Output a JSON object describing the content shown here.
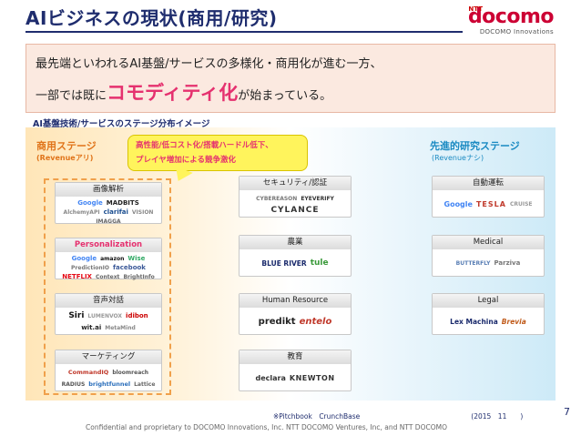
{
  "header": {
    "title": "AIビジネスの現状(商用/研究)",
    "logo_ntt": "NTT",
    "logo_brand": "docomo",
    "logo_sub": "DOCOMO Innovations"
  },
  "callout": {
    "line1": "最先端といわれるAI基盤/サービスの多様化・商用化が進む一方、",
    "line2_prefix": "一部では既に",
    "line2_highlight": "コモディティ化",
    "line2_suffix": "が始まっている。"
  },
  "section_label": "AI基盤技術/サービスのステージ分布イメージ",
  "stages": {
    "left_title": "商用ステージ",
    "left_sub": "(Revenueアリ)",
    "right_title": "先進的研究ステージ",
    "right_sub": "(Revenueナシ)"
  },
  "bubble": {
    "line1": "高性能/低コスト化/搭載ハードル低下、",
    "line2": "プレイヤ増加による競争激化"
  },
  "cards": {
    "image": {
      "label": "画像解析",
      "logos": [
        "Google",
        "MADBITS",
        "AlchemyAPI",
        "clarifai",
        "VISION",
        "IMAGGA"
      ]
    },
    "personalization": {
      "label": "Personalization",
      "logos": [
        "Google",
        "amazon",
        "Wise",
        "PredictionIO",
        "facebook",
        "NETFLIX",
        "Context",
        "BrightInfo"
      ]
    },
    "voice": {
      "label": "音声対話",
      "logos": [
        "Siri",
        "LUMENVOX",
        "wit.ai",
        "idibon",
        "MetaMind"
      ]
    },
    "marketing": {
      "label": "マーケティング",
      "logos": [
        "CommandIQ",
        "bloomreach",
        "RADIUS",
        "brightfunnel",
        "Lattice"
      ]
    },
    "security": {
      "label": "セキュリティ/認証",
      "logos": [
        "CYBEREASON",
        "EYEVERIFY",
        "CYLANCE"
      ]
    },
    "agri": {
      "label": "農業",
      "logos": [
        "BLUE RIVER",
        "tule"
      ]
    },
    "hr": {
      "label": "Human Resource",
      "logos": [
        "predikt",
        "entelo"
      ]
    },
    "edu": {
      "label": "教育",
      "logos": [
        "declara",
        "KNEWTON"
      ]
    },
    "auto": {
      "label": "自動運転",
      "logos": [
        "Google",
        "TESLA",
        "CRUISE"
      ]
    },
    "medical": {
      "label": "Medical",
      "logos": [
        "BUTTERFLY",
        "Parziva"
      ]
    },
    "legal": {
      "label": "Legal",
      "logos": [
        "Lex Machina",
        "Brevia"
      ]
    }
  },
  "footer": {
    "source": "※Pitchbook　CrunchBase",
    "date": "(2015　11　　)",
    "copyright": "Confidential and proprietary to DOCOMO Innovations, Inc. NTT DOCOMO Ventures, Inc, and NTT DOCOMO",
    "page": "7"
  },
  "colors": {
    "title_navy": "#1f2d6e",
    "highlight_pink": "#e5316f",
    "stage_orange": "#e0741a",
    "stage_blue": "#1a8ac2",
    "bubble_yellow": "#fff45c"
  }
}
